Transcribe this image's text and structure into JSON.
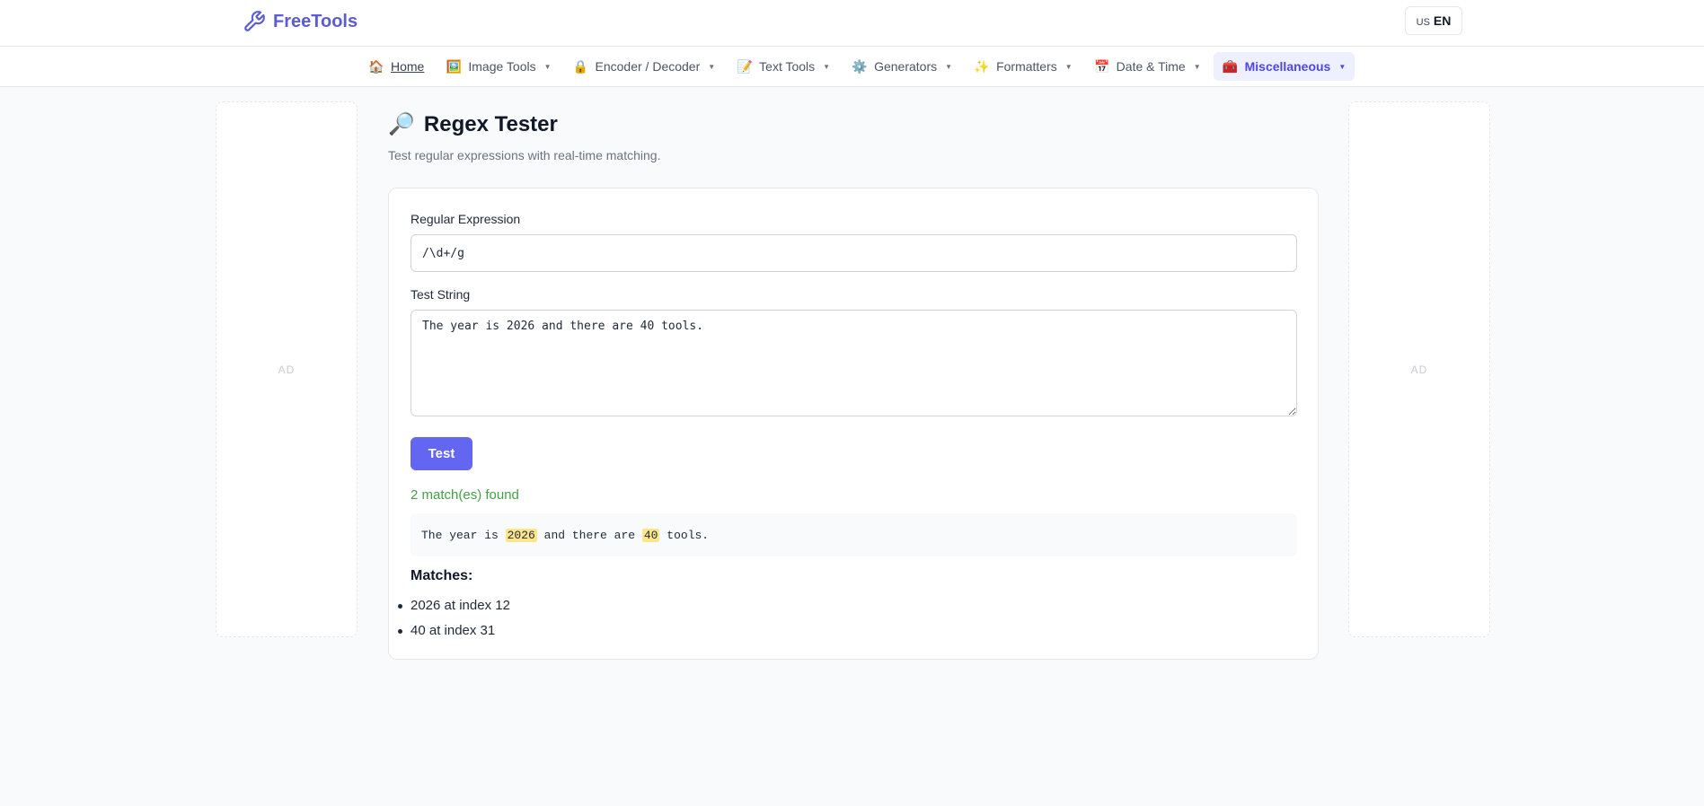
{
  "header": {
    "brand": "FreeTools",
    "lang_flag": "US",
    "lang_code": "EN"
  },
  "nav": {
    "items": [
      {
        "icon": "🏠",
        "label": "Home",
        "dropdown": false
      },
      {
        "icon": "🖼️",
        "label": "Image Tools",
        "dropdown": true
      },
      {
        "icon": "🔒",
        "label": "Encoder / Decoder",
        "dropdown": true
      },
      {
        "icon": "📝",
        "label": "Text Tools",
        "dropdown": true
      },
      {
        "icon": "⚙️",
        "label": "Generators",
        "dropdown": true
      },
      {
        "icon": "✨",
        "label": "Formatters",
        "dropdown": true
      },
      {
        "icon": "📅",
        "label": "Date & Time",
        "dropdown": true
      },
      {
        "icon": "🧰",
        "label": "Miscellaneous",
        "dropdown": true
      }
    ],
    "active": "Miscellaneous"
  },
  "ads": {
    "left": "AD",
    "right": "AD"
  },
  "page": {
    "icon": "🔎",
    "title": "Regex Tester",
    "subtitle": "Test regular expressions with real-time matching."
  },
  "form": {
    "regex_label": "Regular Expression",
    "regex_value": "/\\d+/g",
    "test_label": "Test String",
    "test_value": "The year is 2026 and there are 40 tools.",
    "test_button": "Test"
  },
  "result": {
    "status": "2 match(es) found",
    "segments": [
      {
        "text": "The year is ",
        "match": false
      },
      {
        "text": "2026",
        "match": true
      },
      {
        "text": " and there are ",
        "match": false
      },
      {
        "text": "40",
        "match": true
      },
      {
        "text": " tools.",
        "match": false
      }
    ],
    "matches_title": "Matches:",
    "matches": [
      "2026 at index 12",
      "40 at index 31"
    ]
  },
  "colors": {
    "accent": "#6366f1",
    "brand": "#5b5bd6",
    "success": "#43a047",
    "highlight": "#fde68a"
  }
}
